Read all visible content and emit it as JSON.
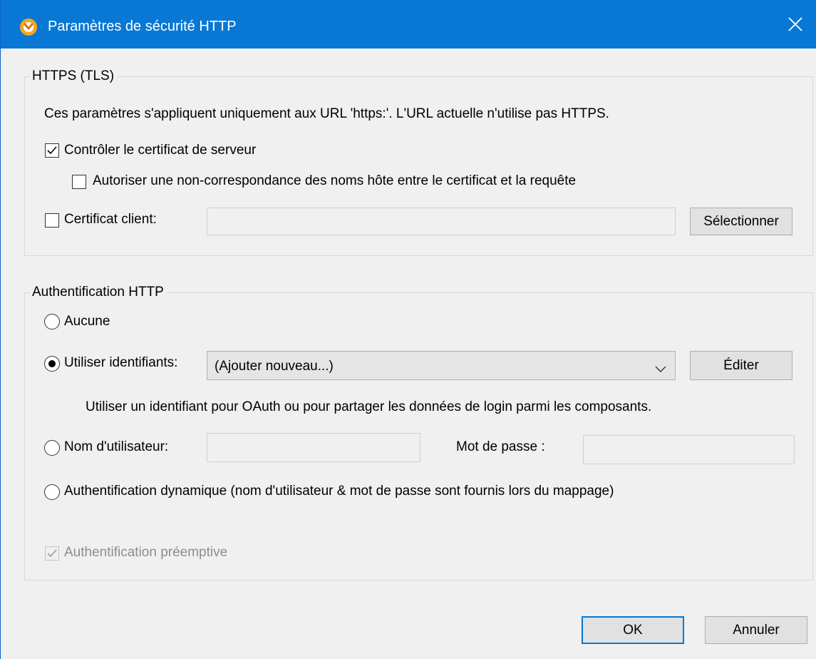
{
  "dialog": {
    "title": "Paramètres de sécurité HTTP",
    "icons": {
      "app": "mapforce-app-icon",
      "close": "close-icon"
    }
  },
  "https": {
    "legend": "HTTPS (TLS)",
    "info": "Ces paramètres s'appliquent uniquement aux URL 'https:'. L'URL actuelle n'utilise pas HTTPS.",
    "check_server_cert": {
      "label": "Contrôler le certificat de serveur",
      "checked": true
    },
    "allow_host_mismatch": {
      "label": "Autoriser une non-correspondance des noms hôte entre le certificat et la requête",
      "checked": false
    },
    "client_cert": {
      "label": "Certificat client:",
      "checked": false,
      "value": ""
    },
    "select_button": "Sélectionner"
  },
  "auth": {
    "legend": "Authentification HTTP",
    "none": {
      "label": "Aucune",
      "selected": false
    },
    "credentials": {
      "label": "Utiliser identifiants:",
      "selected": true,
      "combo_value": "(Ajouter nouveau...)"
    },
    "edit_button": "Éditer",
    "credentials_info": "Utiliser un identifiant pour OAuth ou pour partager les données de login parmi les composants.",
    "username": {
      "label": "Nom d'utilisateur:",
      "selected": false,
      "value": ""
    },
    "password": {
      "label": "Mot de passe :",
      "value": ""
    },
    "dynamic": {
      "label": "Authentification dynamique (nom d'utilisateur & mot de passe sont fournis lors du mappage)",
      "selected": false
    },
    "preemptive": {
      "label": "Authentification préemptive",
      "checked": true,
      "disabled": true
    }
  },
  "footer": {
    "ok": "OK",
    "cancel": "Annuler"
  },
  "colors": {
    "titlebar": "#0878d4",
    "accent": "#0078d7",
    "dialog_bg": "#f0f0f0"
  }
}
